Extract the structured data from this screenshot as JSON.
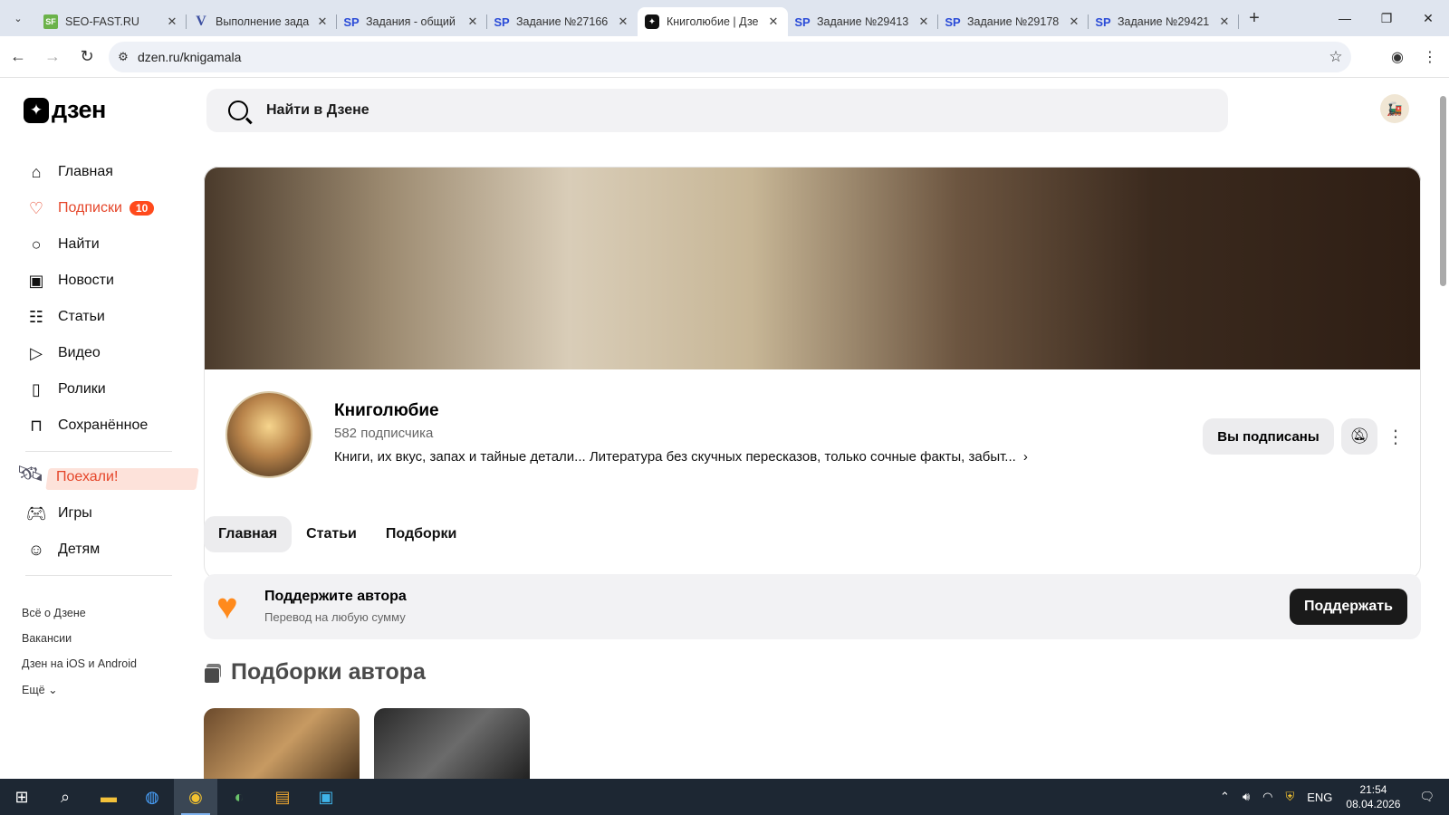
{
  "browser": {
    "tabs": [
      {
        "title": "SEO-FAST.RU",
        "favicon": "SF"
      },
      {
        "title": "Выполнение зада",
        "favicon": "V"
      },
      {
        "title": "Задания - общий",
        "favicon": "SP"
      },
      {
        "title": "Задание №27166",
        "favicon": "SP"
      },
      {
        "title": "Книголюбие | Дзе",
        "favicon": "✦"
      },
      {
        "title": "Задание №29413",
        "favicon": "SP"
      },
      {
        "title": "Задание №29178",
        "favicon": "SP"
      },
      {
        "title": "Задание №29421",
        "favicon": "SP"
      }
    ],
    "active_tab_index": 4,
    "url": "dzen.ru/knigamala"
  },
  "site": {
    "logo_text": "дзен",
    "search_placeholder": "Найти в Дзене"
  },
  "sidebar": {
    "items": [
      {
        "label": "Главная",
        "icon": "home-icon"
      },
      {
        "label": "Подписки",
        "icon": "subscriptions-icon",
        "badge": "10",
        "active": true
      },
      {
        "label": "Найти",
        "icon": "search-icon"
      },
      {
        "label": "Новости",
        "icon": "news-icon"
      },
      {
        "label": "Статьи",
        "icon": "articles-icon"
      },
      {
        "label": "Видео",
        "icon": "video-icon"
      },
      {
        "label": "Ролики",
        "icon": "shorts-icon"
      },
      {
        "label": "Сохранённое",
        "icon": "bookmark-icon"
      }
    ],
    "promo": "Поехали!",
    "extra_items": [
      {
        "label": "Игры",
        "icon": "gamepad-icon"
      },
      {
        "label": "Детям",
        "icon": "kids-icon"
      }
    ],
    "footer_links": [
      "Всё о Дзене",
      "Вакансии",
      "Дзен на iOS и Android",
      "Ещё"
    ]
  },
  "channel": {
    "name": "Книголюбие",
    "subscribers": "582 подписчика",
    "description": "Книги, их вкус, запах и тайные детали... Литература без скучных пересказов, только сочные факты, забыт...",
    "subscribe_label": "Вы подписаны"
  },
  "page_tabs": [
    "Главная",
    "Статьи",
    "Подборки"
  ],
  "support": {
    "title": "Поддержите автора",
    "subtitle": "Перевод на любую сумму",
    "button": "Поддержать"
  },
  "collections": {
    "title": "Подборки автора"
  },
  "taskbar": {
    "language": "ENG",
    "time": "21:54",
    "date": "08.04.2026"
  },
  "colors": {
    "accent": "#e5462a",
    "badge": "#ff4a1c",
    "tabbar": "#dfe5ef",
    "taskbar": "#1d2733"
  }
}
